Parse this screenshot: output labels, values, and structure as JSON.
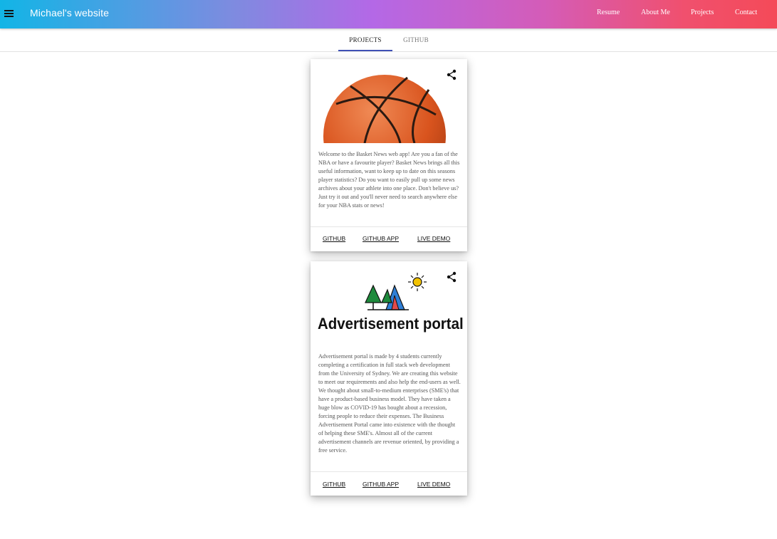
{
  "appbar": {
    "title": "Michael's website",
    "nav": [
      "Resume",
      "About Me",
      "Projects",
      "Contact"
    ]
  },
  "tabs": [
    {
      "label": "PROJECTS",
      "active": true
    },
    {
      "label": "GITHUB",
      "active": false
    }
  ],
  "projects": [
    {
      "image": "basketball",
      "description": "Welcome to the Basket News web app! Are you a fan of the NBA or have a favourite player? Basket News brings all this useful information, want to keep up to date on this seasons player statistics? Do you want to easily pull up some news archives about your athlete into one place. Don't believe us? Just try it out and you'll never need to search anywhere else for your NBA stats or news!",
      "links": [
        "GITHUB",
        "GITHUB APP",
        "LIVE DEMO"
      ]
    },
    {
      "image": "advertisement-portal-logo",
      "logo_text": "Advertisement portal",
      "description": "Advertisement portal is made by 4 students currently completing a certification in full stack web development from the University of Sydney. We are creating this website to meet our requirements and also help the end-users as well. We thought about small-to-medium enterprises (SME's) that have a product-based business model. They have taken a huge blow as COVID-19 has bought about a recession, forcing people to reduce their expenses. The Business Advertisement Portal came into existence with the thought of helping these SME's. Almost all of the current advertisement channels are revenue oriented, by providing a free service.",
      "links": [
        "GITHUB",
        "GITHUB APP",
        "LIVE DEMO"
      ]
    }
  ],
  "colors": {
    "gradient_start": "#12b5e6",
    "gradient_mid": "#b468e6",
    "gradient_end": "#f44a58",
    "tab_indicator": "#3f51b5"
  }
}
